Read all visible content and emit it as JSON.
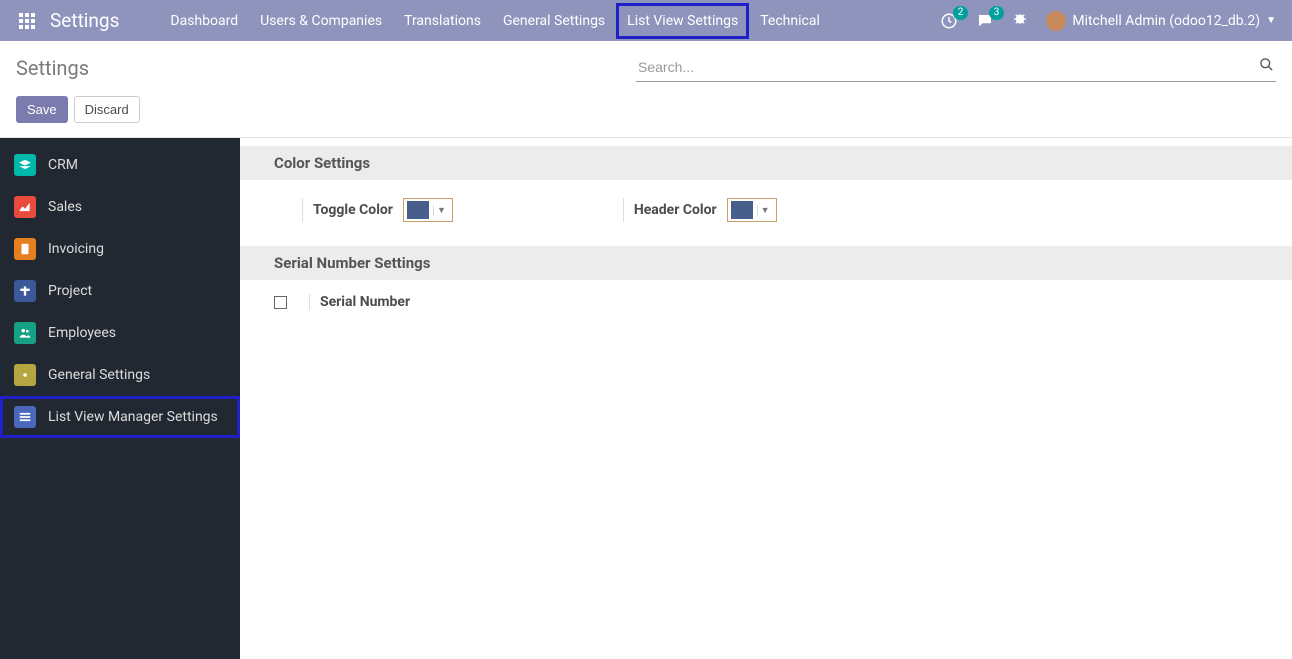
{
  "navbar": {
    "brand": "Settings",
    "menu": [
      {
        "label": "Dashboard"
      },
      {
        "label": "Users & Companies"
      },
      {
        "label": "Translations"
      },
      {
        "label": "General Settings"
      },
      {
        "label": "List View Settings"
      },
      {
        "label": "Technical"
      }
    ],
    "activities_badge": "2",
    "messages_badge": "3",
    "user_name": "Mitchell Admin (odoo12_db.2)"
  },
  "control_panel": {
    "title": "Settings",
    "search_placeholder": "Search...",
    "save_label": "Save",
    "discard_label": "Discard"
  },
  "sidebar": {
    "items": [
      {
        "label": "CRM"
      },
      {
        "label": "Sales"
      },
      {
        "label": "Invoicing"
      },
      {
        "label": "Project"
      },
      {
        "label": "Employees"
      },
      {
        "label": "General Settings"
      },
      {
        "label": "List View Manager Settings"
      }
    ]
  },
  "content": {
    "color_settings_header": "Color Settings",
    "toggle_color_label": "Toggle Color",
    "header_color_label": "Header Color",
    "toggle_color_value": "#475f8a",
    "header_color_value": "#475f8a",
    "serial_number_settings_header": "Serial Number Settings",
    "serial_number_label": "Serial Number",
    "serial_number_checked": false
  }
}
